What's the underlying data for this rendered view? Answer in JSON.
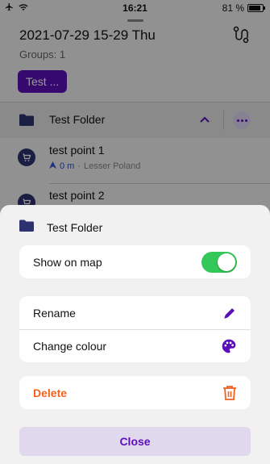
{
  "status_bar": {
    "time": "16:21",
    "battery": "81 %"
  },
  "header": {
    "title": "2021-07-29 15-29 Thu",
    "groups": "Groups: 1",
    "chip": "Test ..."
  },
  "folder": {
    "name": "Test Folder"
  },
  "points": [
    {
      "name": "test point 1",
      "distance": "0 m",
      "region": "Lesser Poland"
    },
    {
      "name": "test point 2"
    }
  ],
  "sheet": {
    "title": "Test Folder",
    "show_on_map": {
      "label": "Show on map",
      "enabled": true
    },
    "rename_label": "Rename",
    "change_colour_label": "Change colour",
    "delete_label": "Delete",
    "close_label": "Close"
  },
  "colors": {
    "accent": "#5a0fb9",
    "danger": "#f0601f",
    "toggle_on": "#34c759",
    "point_icon": "#2d3270"
  }
}
